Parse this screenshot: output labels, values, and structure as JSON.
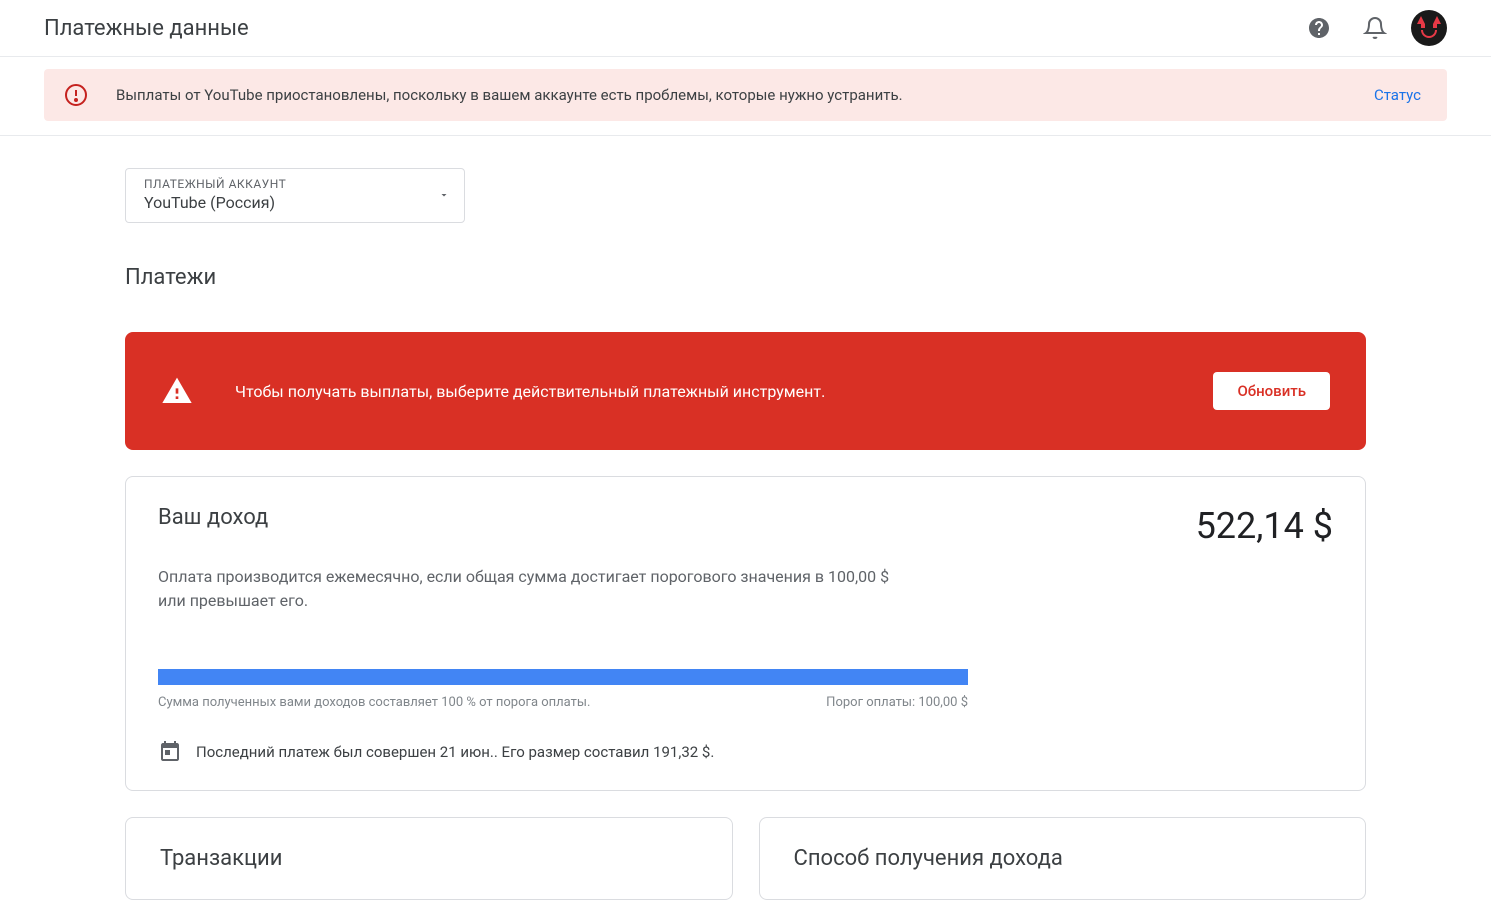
{
  "header": {
    "title": "Платежные данные"
  },
  "alert": {
    "text": "Выплаты от YouTube приостановлены, поскольку в вашем аккаунте есть проблемы, которые нужно устранить.",
    "link": "Статус"
  },
  "accountSelect": {
    "label": "ПЛАТЕЖНЫЙ АККАУНТ",
    "value": "YouTube (Россия)"
  },
  "payments": {
    "title": "Платежи"
  },
  "redBanner": {
    "text": "Чтобы получать выплаты, выберите действительный платежный инструмент.",
    "button": "Обновить"
  },
  "incomeCard": {
    "title": "Ваш доход",
    "amount": "522,14 $",
    "subtitle": "Оплата производится ежемесячно, если общая сумма достигает порогового значения в 100,00 $ или превышает его.",
    "progressLeft": "Сумма полученных вами доходов составляет 100 % от порога оплаты.",
    "progressRight": "Порог оплаты: 100,00 $",
    "lastPayment": "Последний платеж был совершен 21 июн.. Его размер составил 191,32 $."
  },
  "bottomCards": {
    "transactions": "Транзакции",
    "paymentMethod": "Способ получения дохода"
  }
}
